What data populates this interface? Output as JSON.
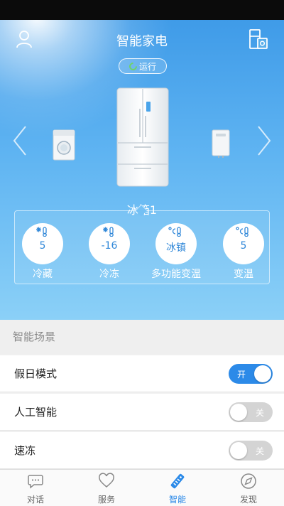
{
  "header": {
    "title": "智能家电",
    "status": "运行"
  },
  "device": {
    "name": "冰箱1"
  },
  "zones": [
    {
      "label": "冷藏",
      "value": "5",
      "icon": "snowflake-thermometer-icon"
    },
    {
      "label": "冷冻",
      "value": "-16",
      "icon": "snowflake-thermometer-icon"
    },
    {
      "label": "多功能变温",
      "value": "冰镇",
      "icon": "celsius-thermometer-icon"
    },
    {
      "label": "变温",
      "value": "5",
      "icon": "celsius-thermometer-icon"
    }
  ],
  "scene_section": {
    "title": "智能场景"
  },
  "settings": [
    {
      "label": "假日模式",
      "state": "开",
      "on": true
    },
    {
      "label": "人工智能",
      "state": "关",
      "on": false
    },
    {
      "label": "速冻",
      "state": "关",
      "on": false
    }
  ],
  "tabs": [
    {
      "label": "对话",
      "icon": "chat-icon",
      "active": false
    },
    {
      "label": "服务",
      "icon": "heart-icon",
      "active": false
    },
    {
      "label": "智能",
      "icon": "remote-icon",
      "active": true
    },
    {
      "label": "发现",
      "icon": "compass-icon",
      "active": false
    }
  ],
  "colors": {
    "accent": "#2c8ae8",
    "hero_top": "#3f9be8",
    "hero_bottom": "#8bd0f7",
    "status_green": "#6fd36b",
    "toggle_off": "#d4d4d4"
  }
}
